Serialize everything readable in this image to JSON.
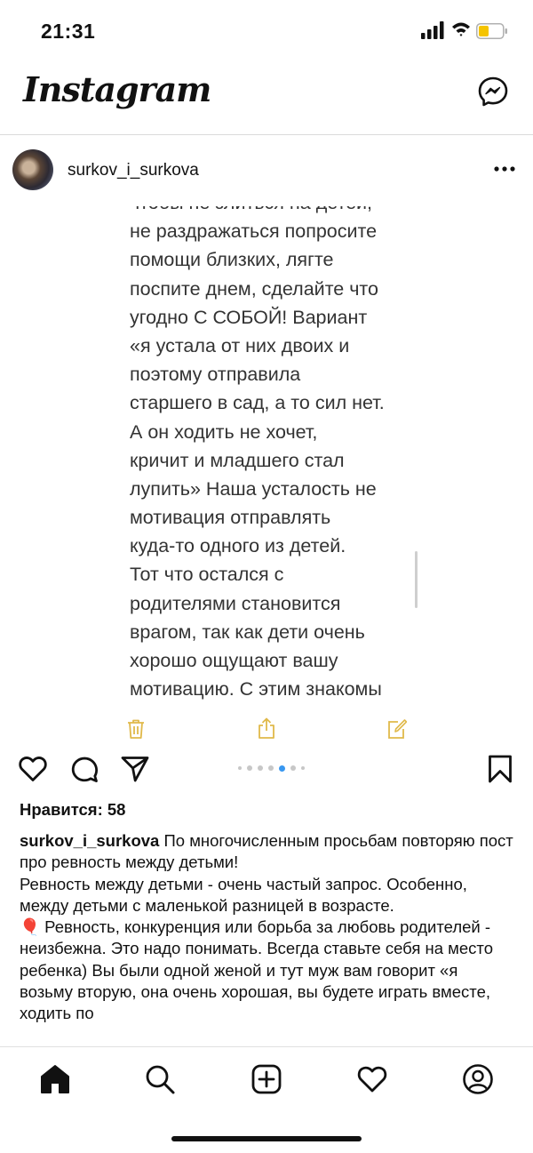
{
  "status_bar": {
    "time": "21:31",
    "battery_color": "#f5c400"
  },
  "header": {
    "logo": "Instagram",
    "messenger_icon": "messenger-icon"
  },
  "post": {
    "username": "surkov_i_surkova",
    "screenshot_text_lines": [
      "чтобы не злиться на детей,",
      "не раздражаться попросите",
      "помощи близких, лягте",
      "поспите днем, сделайте что",
      "угодно С СОБОЙ! Вариант",
      "«я устала от них двоих и",
      "поэтому отправила",
      "старшего в сад, а то сил нет.",
      "А он ходить не хочет,",
      "кричит и младшего стал",
      "лупить» Наша усталость не",
      "мотивация отправлять",
      "куда-то одного из детей.",
      "Тот что остался с",
      "родителями становится",
      "врагом, так как дети очень",
      "хорошо ощущают вашу",
      "мотивацию. С этим знакомы"
    ],
    "notes_accent_color": "#e0b94a",
    "carousel": {
      "total": 7,
      "active_index": 4
    },
    "likes_text": "Нравится: 58",
    "caption": {
      "username": "surkov_i_surkova",
      "text1": " По многочисленным просьбам повторяю пост про ревность между детьми!",
      "text2": "Ревность между детьми - очень частый запрос. Особенно, между детьми с маленькой разницей в возрасте.",
      "balloon": "🎈",
      "text3": " Ревность, конкуренция или борьба за любовь родителей - неизбежна. Это надо понимать. Всегда ставьте себя на место ребенка) Вы были одной женой и тут муж вам говорит «я возьму вторую, она очень хорошая, вы будете играть вместе, ходить по"
    }
  },
  "tab_bar": [
    "home-icon",
    "search-icon",
    "new-post-icon",
    "activity-heart-icon",
    "profile-icon"
  ]
}
